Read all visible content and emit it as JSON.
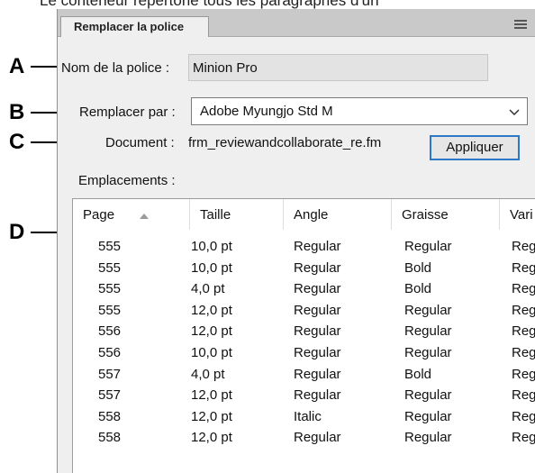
{
  "caption": "Le conteneur répertorie tous les paragraphes d'un",
  "callouts": [
    "A",
    "B",
    "C",
    "D"
  ],
  "panel": {
    "tab_title": "Remplacer la police",
    "menu_icon": "hamburger-menu-icon",
    "font_name_label": "Nom de la police :",
    "font_name_value": "Minion Pro",
    "replace_label": "Remplacer par :",
    "replace_value": "Adobe Myungjo Std M",
    "document_label": "Document :",
    "document_value": "frm_reviewandcollaborate_re.fm",
    "apply_button": "Appliquer",
    "locations_label": "Emplacements :"
  },
  "table": {
    "columns": [
      "Page",
      "Taille",
      "Angle",
      "Graisse",
      "Vari"
    ],
    "sorted_column": "Page",
    "rows": [
      [
        "555",
        "10,0 pt",
        "Regular",
        "Regular",
        "Reg"
      ],
      [
        "555",
        "10,0 pt",
        "Regular",
        "Bold",
        "Reg"
      ],
      [
        "555",
        "4,0 pt",
        "Regular",
        "Bold",
        "Reg"
      ],
      [
        "555",
        "12,0 pt",
        "Regular",
        "Regular",
        "Reg"
      ],
      [
        "556",
        "12,0 pt",
        "Regular",
        "Regular",
        "Reg"
      ],
      [
        "556",
        "10,0 pt",
        "Regular",
        "Regular",
        "Reg"
      ],
      [
        "557",
        "4,0 pt",
        "Regular",
        "Bold",
        "Reg"
      ],
      [
        "557",
        "12,0 pt",
        "Regular",
        "Regular",
        "Reg"
      ],
      [
        "558",
        "12,0 pt",
        "Italic",
        "Regular",
        "Reg"
      ],
      [
        "558",
        "12,0 pt",
        "Regular",
        "Regular",
        "Reg"
      ]
    ]
  },
  "colors": {
    "accent": "#2b78c9",
    "panel_bg": "#efefef",
    "tab_bar": "#c9c9c9"
  }
}
